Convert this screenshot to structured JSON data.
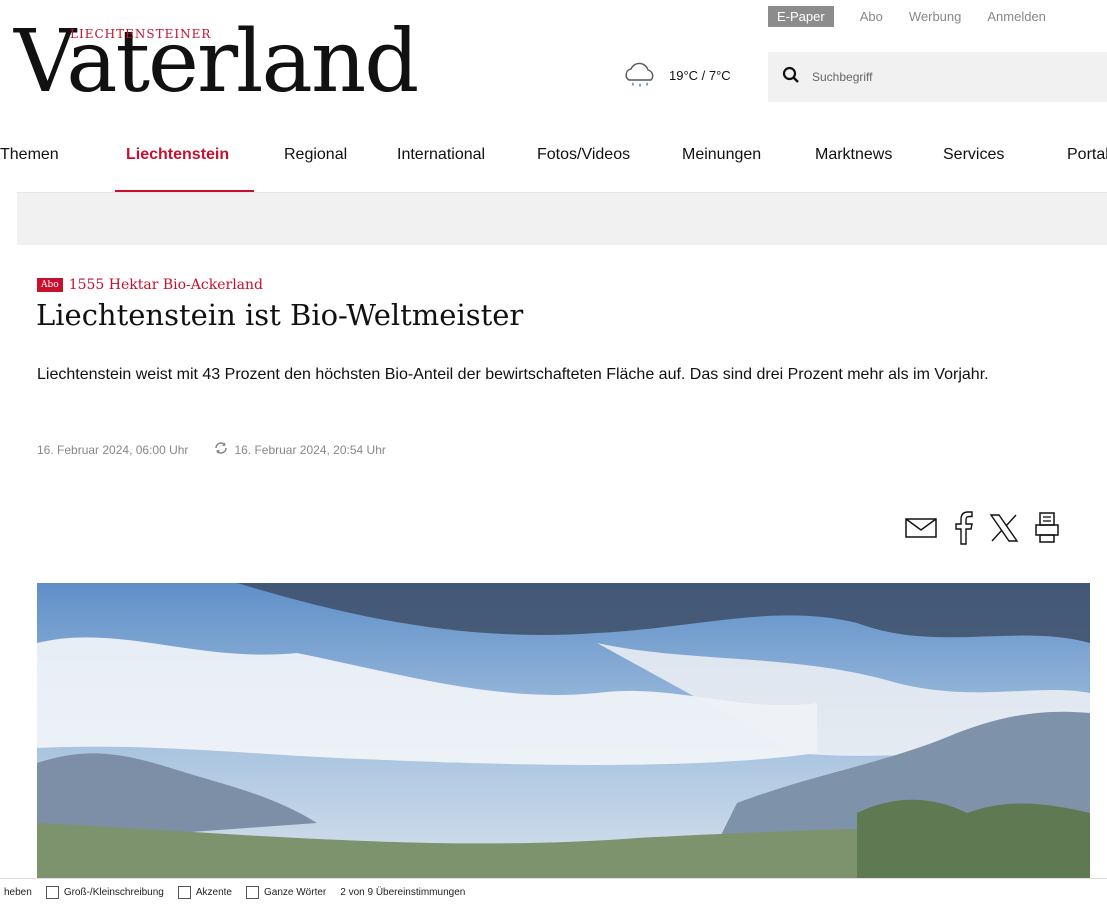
{
  "topbar": {
    "epaper": "E-Paper",
    "abo": "Abo",
    "werbung": "Werbung",
    "anmelden": "Anmelden"
  },
  "logo": {
    "overline": "LIECHTENSTEINER",
    "wordmark": "Vaterland"
  },
  "weather": {
    "icon": "rain-cloud-icon",
    "temperature": "19°C / 7°C"
  },
  "search": {
    "placeholder": "Suchbegriff"
  },
  "nav": {
    "items": [
      {
        "label": "Themen"
      },
      {
        "label": "Liechtenstein",
        "active": true
      },
      {
        "label": "Regional"
      },
      {
        "label": "International"
      },
      {
        "label": "Fotos/Videos"
      },
      {
        "label": "Meinungen"
      },
      {
        "label": "Marktnews"
      },
      {
        "label": "Services"
      },
      {
        "label": "Portale"
      }
    ]
  },
  "article": {
    "badge": "Abo",
    "kicker": "1555 Hektar Bio-Ackerland",
    "headline": "Liechtenstein ist Bio-Weltmeister",
    "lead": "Liechtenstein weist mit 43 Prozent den höchsten Bio-Anteil der bewirtschafteten Fläche auf. Das sind drei Prozent mehr als im Vorjahr.",
    "published": "16. Februar 2024, 06:00 Uhr",
    "updated": "16. Februar 2024, 20:54 Uhr"
  },
  "share": {
    "icons": [
      "mail-icon",
      "facebook-icon",
      "x-icon",
      "print-icon"
    ]
  },
  "findbar": {
    "highlight_fragment": "heben",
    "match_case": "Groß-/Kleinschreibung",
    "diacritics": "Akzente",
    "whole_words": "Ganze Wörter",
    "result": "2 von 9 Übereinstimmungen"
  },
  "colors": {
    "brand_red": "#c8102e",
    "epaper_bg": "#8c8c8c",
    "search_bg": "#f1f1f1"
  }
}
